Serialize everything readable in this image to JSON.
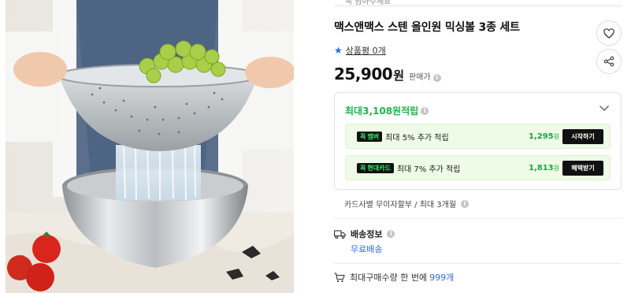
{
  "header": {
    "top_link": "꼭 담아주세요"
  },
  "product": {
    "title": "맥스앤맥스 스텐 올인원 믹싱볼 3종 세트",
    "review_text": "상품평 0개",
    "price": "25,900",
    "price_unit": "원",
    "price_tag": "판매가",
    "info_glyph": "i"
  },
  "actions": {
    "wishlist_icon": "heart-icon",
    "share_icon": "share-icon"
  },
  "reward": {
    "prefix": "최대 ",
    "amount": "3,108원",
    "suffix": " 적립",
    "benefits": [
      {
        "badge_num": "꼭",
        "badge_label": "멤버",
        "desc": "최대 5% 추가 적립",
        "amount": "1,295",
        "unit": "원",
        "cta": "시작하기"
      },
      {
        "badge_num": "꼭",
        "badge_label": "현대카드",
        "desc": "최대 7% 추가 적립",
        "amount": "1,813",
        "unit": "원",
        "cta": "혜택받기"
      }
    ]
  },
  "installment": "카드사별 무이자할부 / 최대 3개월",
  "shipping": {
    "label": "배송정보",
    "value": "무료배송"
  },
  "max_purchase": {
    "label": "최대구매수량 한 번에",
    "value": "999개"
  },
  "colors": {
    "accent_green": "#1bb54b",
    "link_blue": "#2f6be6",
    "badge_bg": "#111111"
  }
}
